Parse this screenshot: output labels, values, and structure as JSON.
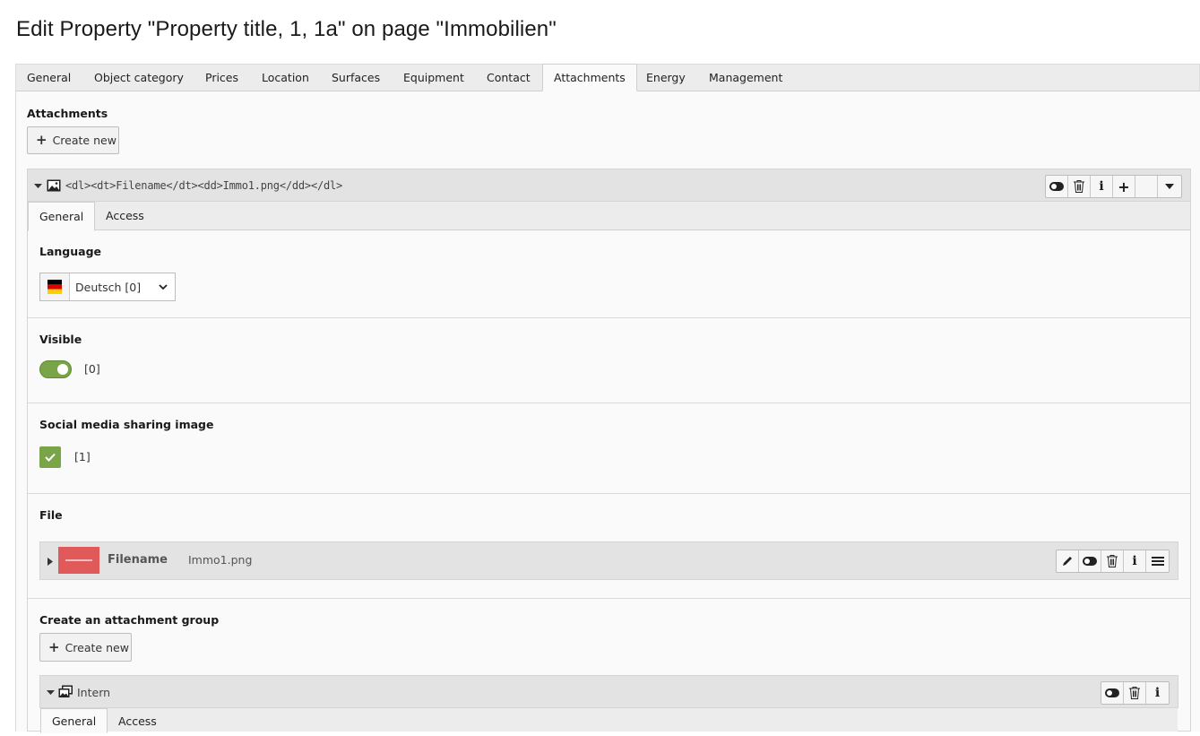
{
  "page": {
    "title": "Edit Property \"Property title, 1, 1a\" on page \"Immobilien\""
  },
  "tabs": [
    {
      "label": "General"
    },
    {
      "label": "Object category"
    },
    {
      "label": "Prices"
    },
    {
      "label": "Location"
    },
    {
      "label": "Surfaces"
    },
    {
      "label": "Equipment"
    },
    {
      "label": "Contact"
    },
    {
      "label": "Attachments",
      "active": true
    },
    {
      "label": "Energy"
    },
    {
      "label": "Management"
    }
  ],
  "attachments": {
    "label": "Attachments",
    "create_new_label": "Create new",
    "record": {
      "title": "<dl><dt>Filename</dt><dd>Immo1.png</dd></dl>",
      "icon": "image-icon",
      "tabs": [
        {
          "label": "General",
          "active": true
        },
        {
          "label": "Access"
        }
      ],
      "language": {
        "label": "Language",
        "flag": "de-flag-icon",
        "value": "Deutsch [0]"
      },
      "visible": {
        "label": "Visible",
        "value": "[0]",
        "on": true
      },
      "social_image": {
        "label": "Social media sharing image",
        "value": "[1]",
        "checked": true
      },
      "file": {
        "label": "File",
        "filename_label": "Filename",
        "filename_value": "Immo1.png",
        "thumb_color": "#e05a5a"
      },
      "group": {
        "label": "Create an attachment group",
        "create_new_label": "Create new",
        "record": {
          "title": "Intern",
          "icon": "images-group-icon",
          "tabs": [
            {
              "label": "General",
              "active": true
            },
            {
              "label": "Access"
            }
          ]
        }
      }
    }
  },
  "colors": {
    "accent_green": "#79a548",
    "header_gray": "#e3e3e3"
  }
}
